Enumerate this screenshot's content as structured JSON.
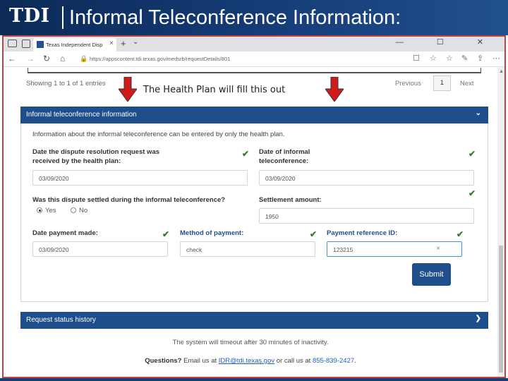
{
  "slide": {
    "logo": "TDI",
    "title": "Informal Teleconference Information:"
  },
  "browser": {
    "tab_title": "Texas Independent Disp",
    "tab_close": "×",
    "new_tab": "+",
    "tab_menu": "⌄",
    "url": "https://appscontent.tdi.texas.gov/medsrb/requestDetails/801",
    "window_controls": "— ☐ ✕"
  },
  "table_footer": {
    "showing": "Showing 1 to 1 of 1 entries",
    "previous": "Previous",
    "page": "1",
    "next": "Next"
  },
  "annotation": {
    "text": "The Health Plan will fill this out",
    "color": "#d11a1a"
  },
  "panel_informal": {
    "header": "Informal teleconference information",
    "intro": "Information about the informal teleconference can be entered by only the health plan.",
    "date_received_label": "Date the dispute resolution request was received by the health plan:",
    "date_received_value": "03/09/2020",
    "date_informal_label": "Date of informal teleconference:",
    "date_informal_value": "03/09/2020",
    "settled_label": "Was this dispute settled during the informal teleconference?",
    "settled_options": [
      "Yes",
      "No"
    ],
    "settled_selected": "Yes",
    "settlement_label": "Settlement amount:",
    "settlement_value": "1950",
    "payment_date_label": "Date payment made:",
    "payment_date_value": "03/09/2020",
    "method_label": "Method of payment:",
    "method_value": "check",
    "reference_label": "Payment reference ID:",
    "reference_value": "123215",
    "clear": "×",
    "submit": "Submit"
  },
  "panel_status": {
    "header": "Request status history"
  },
  "footer": {
    "timeout": "The system will timeout after 30 minutes of inactivity.",
    "questions_prefix": "Questions?",
    "email_text": " Email us at ",
    "email": "IDR@tdi.texas.gov",
    "call_text": " or call us at ",
    "phone": "855-839-2427",
    "period": "."
  },
  "colors": {
    "header_blue": "#1f4e8c",
    "check_green": "#2f7d32",
    "frame_red": "#b94545"
  }
}
